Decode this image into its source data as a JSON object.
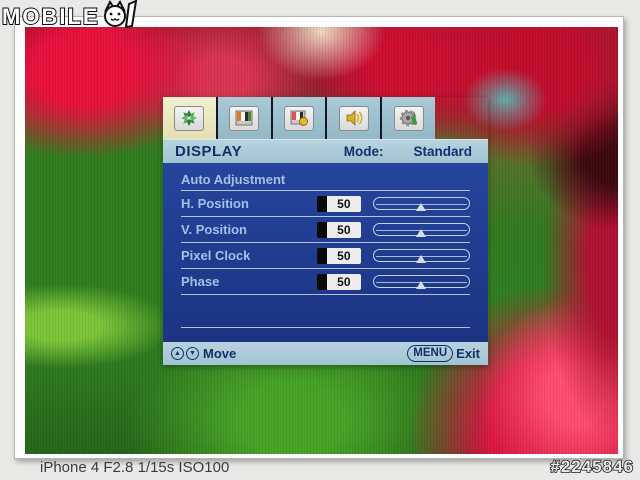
{
  "watermark": {
    "brand": "MOBILE",
    "suffix": "01"
  },
  "caption": {
    "exif": "iPhone 4 F2.8 1/15s ISO100",
    "photo_id": "#2245846"
  },
  "osd": {
    "tabs": [
      {
        "name": "display",
        "icon": "pinwheel-icon",
        "selected": true
      },
      {
        "name": "picture",
        "icon": "color-bars-icon",
        "selected": false
      },
      {
        "name": "color",
        "icon": "color-bars-badge-icon",
        "selected": false
      },
      {
        "name": "audio",
        "icon": "speaker-icon",
        "selected": false
      },
      {
        "name": "system",
        "icon": "gear-tool-icon",
        "selected": false
      }
    ],
    "header": {
      "title": "DISPLAY",
      "mode_label": "Mode:",
      "mode_value": "Standard"
    },
    "menu": {
      "auto_adjustment_label": "Auto Adjustment",
      "items": [
        {
          "label": "H. Position",
          "value": "50",
          "slider_percent": 50
        },
        {
          "label": "V. Position",
          "value": "50",
          "slider_percent": 50
        },
        {
          "label": "Pixel Clock",
          "value": "50",
          "slider_percent": 50
        },
        {
          "label": "Phase",
          "value": "50",
          "slider_percent": 50
        }
      ]
    },
    "footer": {
      "up_glyph": "▲",
      "down_glyph": "▼",
      "move_label": "Move",
      "menu_button": "MENU",
      "exit_label": "Exit"
    },
    "colors": {
      "body_bg": "#1e3a8e",
      "bar_bg": "#a9c9d6",
      "selected_tab_bg": "#eceac2",
      "tab_bg": "#9fc2d0",
      "label_text": "#a3c0e8",
      "bar_text": "#13306b"
    }
  }
}
